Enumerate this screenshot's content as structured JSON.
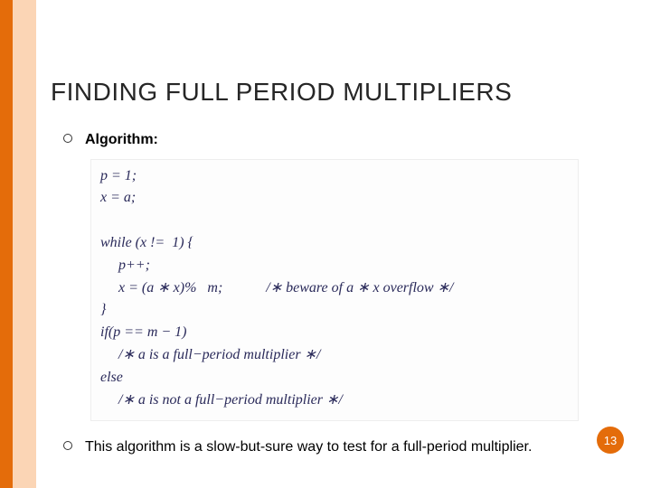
{
  "accent_bg": "#fbd5b5",
  "accent_fg": "#e46c0a",
  "title": "FINDING FULL PERIOD MULTIPLIERS",
  "bullets": [
    {
      "label": "Algorithm:",
      "bold": true
    },
    {
      "label": "This algorithm is a slow-but-sure way to test for a full-period multiplier.",
      "bold": false
    }
  ],
  "code_lines": [
    "p = 1;",
    "x = a;",
    "",
    "while (x !=  1) {",
    "     p++;",
    "     x = (a ∗ x)%   m;            /∗ beware of a ∗ x overflow ∗/",
    "}",
    "if(p == m − 1)",
    "     /∗ a is a full−period multiplier ∗/",
    "else",
    "     /∗ a is not a full−period multiplier ∗/"
  ],
  "page_number": "13"
}
